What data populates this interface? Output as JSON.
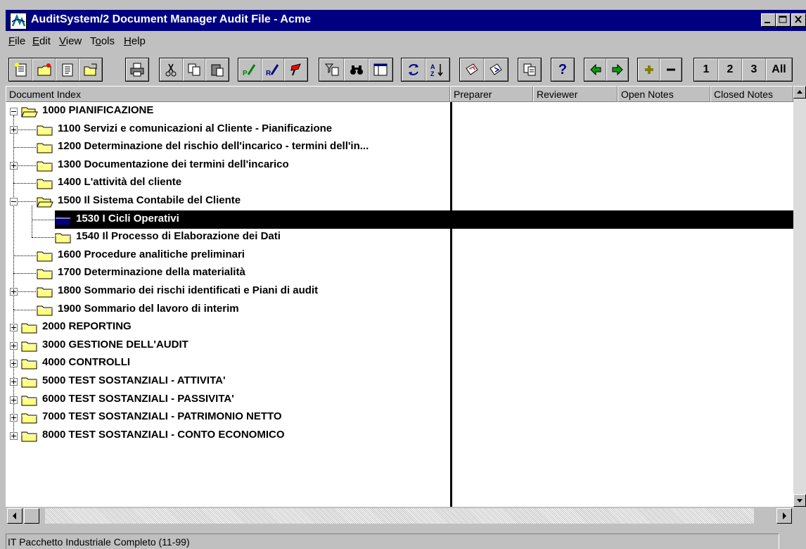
{
  "window": {
    "title": "AuditSystem/2 Document Manager Audit File - Acme"
  },
  "menu": [
    {
      "label": "File"
    },
    {
      "label": "Edit"
    },
    {
      "label": "View"
    },
    {
      "label": "Tools"
    },
    {
      "label": "Help"
    }
  ],
  "toolbar": {
    "icons": [
      "new-document-icon",
      "new-folder-icon",
      "document-icon",
      "open-folder-icon",
      "print-icon",
      "cut-icon",
      "copy-icon",
      "paste-icon",
      "prepared-signoff-icon",
      "reviewed-signoff-icon",
      "flag-icon",
      "filter-icon",
      "binoculars-icon",
      "view-panel-icon",
      "refresh-icon",
      "sort-icon",
      "roll-forward-icon",
      "roll-back-icon",
      "duplicate-icon",
      "help-icon",
      "arrow-left-icon",
      "arrow-right-icon",
      "plus-icon",
      "minus-icon"
    ],
    "level_buttons": [
      "1",
      "2",
      "3",
      "All"
    ],
    "help_label": "?"
  },
  "columns": {
    "index": "Document Index",
    "preparer": "Preparer",
    "reviewer": "Reviewer",
    "open_notes": "Open Notes",
    "closed_notes": "Closed Notes"
  },
  "tree": [
    {
      "label": "1000 PIANIFICAZIONE",
      "level": 0,
      "expander": "minus",
      "open": true
    },
    {
      "label": "1100 Servizi e comunicazioni al Cliente - Pianificazione",
      "level": 1,
      "expander": "plus"
    },
    {
      "label": "1200 Determinazione del rischio dell'incarico - termini dell'in...",
      "level": 1,
      "expander": ""
    },
    {
      "label": "1300 Documentazione dei termini dell'incarico",
      "level": 1,
      "expander": "plus"
    },
    {
      "label": "1400 L'attività del cliente",
      "level": 1,
      "expander": ""
    },
    {
      "label": "1500 Il Sistema Contabile del Cliente",
      "level": 1,
      "expander": "minus",
      "open": true
    },
    {
      "label": "1530 I Cicli Operativi",
      "level": 2,
      "expander": "",
      "selected": true
    },
    {
      "label": "1540 Il Processo di Elaborazione dei Dati",
      "level": 2,
      "expander": ""
    },
    {
      "label": "1600 Procedure analitiche preliminari",
      "level": 1,
      "expander": ""
    },
    {
      "label": "1700 Determinazione della materialità",
      "level": 1,
      "expander": ""
    },
    {
      "label": "1800 Sommario dei rischi identificati e Piani di audit",
      "level": 1,
      "expander": "plus"
    },
    {
      "label": "1900 Sommario del lavoro di interim",
      "level": 1,
      "expander": ""
    },
    {
      "label": "2000 REPORTING",
      "level": 0,
      "expander": "plus"
    },
    {
      "label": "3000 GESTIONE DELL'AUDIT",
      "level": 0,
      "expander": "plus"
    },
    {
      "label": "4000 CONTROLLI",
      "level": 0,
      "expander": "plus"
    },
    {
      "label": "5000 TEST SOSTANZIALI - ATTIVITA'",
      "level": 0,
      "expander": "plus"
    },
    {
      "label": "6000 TEST SOSTANZIALI - PASSIVITA'",
      "level": 0,
      "expander": "plus"
    },
    {
      "label": "7000 TEST SOSTANZIALI - PATRIMONIO NETTO",
      "level": 0,
      "expander": "plus"
    },
    {
      "label": "8000 TEST SOSTANZIALI - CONTO ECONOMICO",
      "level": 0,
      "expander": "plus"
    }
  ],
  "status": {
    "text": "IT Pacchetto Industriale Completo (11-99)"
  },
  "colors": {
    "title_bar": "#000080",
    "selection": "#000000",
    "folder": "#ffff80",
    "selected_folder": "#000080"
  }
}
